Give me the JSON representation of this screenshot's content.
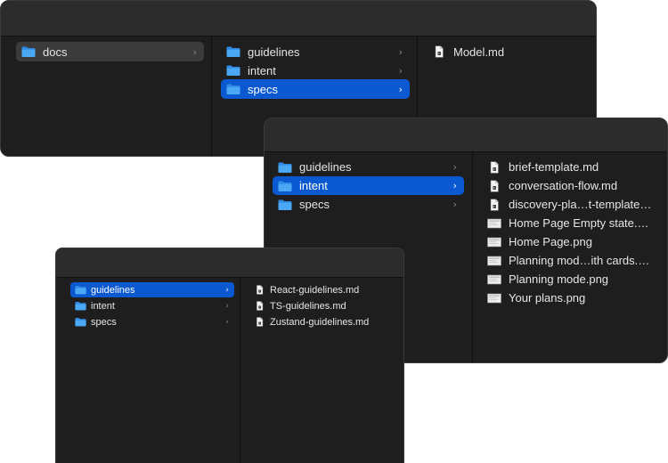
{
  "colors": {
    "window_bg": "#1e1e1e",
    "titlebar_bg": "#2c2c2c",
    "selection": "#0a59d0",
    "folder_blue": "#3d9cf0",
    "text": "#e6e6e6"
  },
  "windows": [
    {
      "columns": [
        {
          "items": [
            {
              "label": "docs",
              "icon": "folder-icon",
              "chevron": true,
              "state": "dim"
            }
          ]
        },
        {
          "items": [
            {
              "label": "guidelines",
              "icon": "folder-icon",
              "chevron": true,
              "state": ""
            },
            {
              "label": "intent",
              "icon": "folder-icon",
              "chevron": true,
              "state": ""
            },
            {
              "label": "specs",
              "icon": "folder-icon",
              "chevron": true,
              "state": "selected"
            }
          ]
        },
        {
          "items": [
            {
              "label": "Model.md",
              "icon": "document-icon",
              "chevron": false,
              "state": ""
            }
          ]
        }
      ]
    },
    {
      "columns": [
        {
          "items": [
            {
              "label": "guidelines",
              "icon": "folder-icon",
              "chevron": true,
              "state": ""
            },
            {
              "label": "intent",
              "icon": "folder-icon",
              "chevron": true,
              "state": "selected"
            },
            {
              "label": "specs",
              "icon": "folder-icon",
              "chevron": true,
              "state": ""
            }
          ]
        },
        {
          "items": [
            {
              "label": "brief-template.md",
              "icon": "document-icon",
              "chevron": false,
              "state": ""
            },
            {
              "label": "conversation-flow.md",
              "icon": "document-icon",
              "chevron": false,
              "state": ""
            },
            {
              "label": "discovery-pla…t-template.md",
              "icon": "document-icon",
              "chevron": false,
              "state": ""
            },
            {
              "label": "Home Page Empty state.png",
              "icon": "image-icon",
              "chevron": false,
              "state": ""
            },
            {
              "label": "Home Page.png",
              "icon": "image-icon",
              "chevron": false,
              "state": ""
            },
            {
              "label": "Planning mod…ith cards.png",
              "icon": "image-icon",
              "chevron": false,
              "state": ""
            },
            {
              "label": "Planning mode.png",
              "icon": "image-icon",
              "chevron": false,
              "state": ""
            },
            {
              "label": "Your plans.png",
              "icon": "image-icon",
              "chevron": false,
              "state": ""
            }
          ]
        }
      ]
    },
    {
      "columns": [
        {
          "items": [
            {
              "label": "guidelines",
              "icon": "folder-icon",
              "chevron": true,
              "state": "selected"
            },
            {
              "label": "intent",
              "icon": "folder-icon",
              "chevron": true,
              "state": ""
            },
            {
              "label": "specs",
              "icon": "folder-icon",
              "chevron": true,
              "state": ""
            }
          ]
        },
        {
          "items": [
            {
              "label": "React-guidelines.md",
              "icon": "document-icon",
              "chevron": false,
              "state": ""
            },
            {
              "label": "TS-guidelines.md",
              "icon": "document-icon",
              "chevron": false,
              "state": ""
            },
            {
              "label": "Zustand-guidelines.md",
              "icon": "document-icon",
              "chevron": false,
              "state": ""
            }
          ]
        }
      ]
    }
  ]
}
